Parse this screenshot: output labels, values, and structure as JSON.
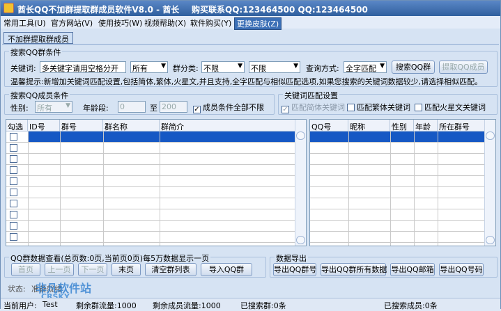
{
  "window": {
    "title": "酋长QQ不加群提取群成员软件V8.0 - 酋长",
    "contact": "购买联系QQ:123464500 QQ:123464500"
  },
  "menu": [
    "常用工具(U)",
    "官方网站(V)",
    "使用技巧(W)",
    "视频帮助(X)",
    "软件购买(Y)",
    "更换皮肤(Z)"
  ],
  "tab": "不加群提取群成员",
  "search": {
    "group_title": "搜索QQ群条件",
    "keyword_label": "关键词:",
    "keyword_value": "多关键字请用空格分开",
    "category1": "所有",
    "category_label": "群分类:",
    "category2": "不限",
    "category3": "不限",
    "query_label": "查询方式:",
    "query_value": "全字匹配",
    "search_btn": "搜索QQ群",
    "extract_btn": "提取QQ成员",
    "tip": "温馨提示:新增加关键词匹配设置,包括简体,繁体,火星文,并且支持,全字匹配与相似匹配选项,如果您搜索的关键词数据较少,请选择相似匹配。"
  },
  "member": {
    "group_title": "搜索QQ成员条件",
    "gender_label": "性别:",
    "gender_value": "所有",
    "age_label": "年龄段:",
    "age_from": "0",
    "age_to_label": "至",
    "age_to": "200",
    "unlimited_label": "成员条件全部不限"
  },
  "keyword_match": {
    "group_title": "关键词匹配设置",
    "simplified": "匹配简体关键词",
    "traditional": "匹配繁体关键词",
    "martian": "匹配火星文关键词"
  },
  "group_table": {
    "headers": [
      "勾选",
      "ID号",
      "群号",
      "群名称",
      "群简介"
    ]
  },
  "member_table": {
    "headers": [
      "QQ号",
      "昵称",
      "性别",
      "年龄",
      "所在群号"
    ]
  },
  "paging": {
    "title": "QQ群数据查看(总页数:0页,当前页0页)每5万数据显示一页",
    "first": "首页",
    "prev": "上一页",
    "next": "下一页",
    "last": "末页",
    "clear": "清空群列表",
    "import": "导入QQ群"
  },
  "export": {
    "title": "数据导出",
    "btn1": "导出QQ群号",
    "btn2": "导出QQ群所有数据",
    "btn3": "导出QQ邮箱",
    "btn4": "导出QQ号码"
  },
  "status": {
    "state_label": "状态:",
    "state_value": "准备就绪",
    "user_label": "当前用户:",
    "user_value": "Test",
    "remain_groups": "剩余群流量:1000",
    "remain_members": "剩余成员流量:1000",
    "searched_groups": "已搜索群:0条",
    "searched_members": "已搜索成员:0条"
  },
  "watermark": {
    "text": "非凡软件站",
    "sub": "CRSKY"
  }
}
